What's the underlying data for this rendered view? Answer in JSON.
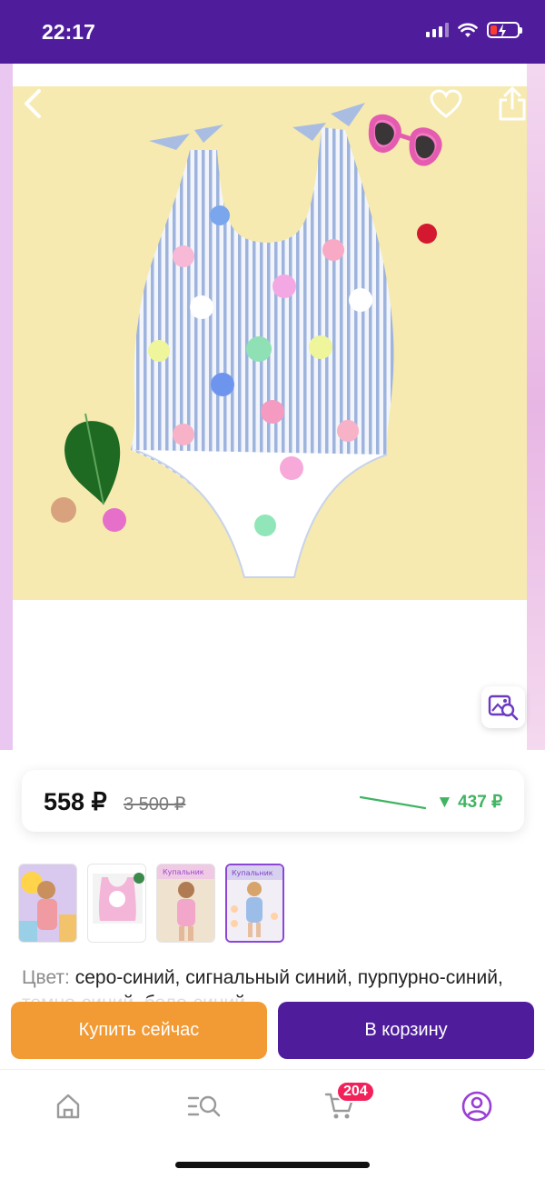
{
  "status_bar": {
    "time": "22:17"
  },
  "header": {
    "back_icon": "chevron-left-icon",
    "favorite_icon": "heart-icon",
    "share_icon": "share-icon"
  },
  "gallery": {
    "image_search_icon": "image-search-icon"
  },
  "price": {
    "current": "558 ₽",
    "old": "3 500 ₽",
    "drop": "▼ 437 ₽",
    "drop_color": "#3fb461"
  },
  "thumbnails": [
    {
      "selected": false
    },
    {
      "selected": false
    },
    {
      "selected": false
    },
    {
      "selected": true
    }
  ],
  "color": {
    "label": "Цвет:",
    "value": "серо-синий, сигнальный синий, пурпурно-синий, темно-синий, бело-синий"
  },
  "actions": {
    "buy_now": "Купить сейчас",
    "add_to_cart": "В корзину"
  },
  "tabbar": {
    "home_icon": "home-icon",
    "catalog_icon": "catalog-search-icon",
    "cart_icon": "cart-icon",
    "cart_badge": "204",
    "profile_icon": "profile-icon"
  },
  "colors": {
    "brand_purple": "#4f1d9c",
    "buy_orange": "#f29a34",
    "badge_red": "#f2215a",
    "accent_violet": "#8b46d6"
  }
}
